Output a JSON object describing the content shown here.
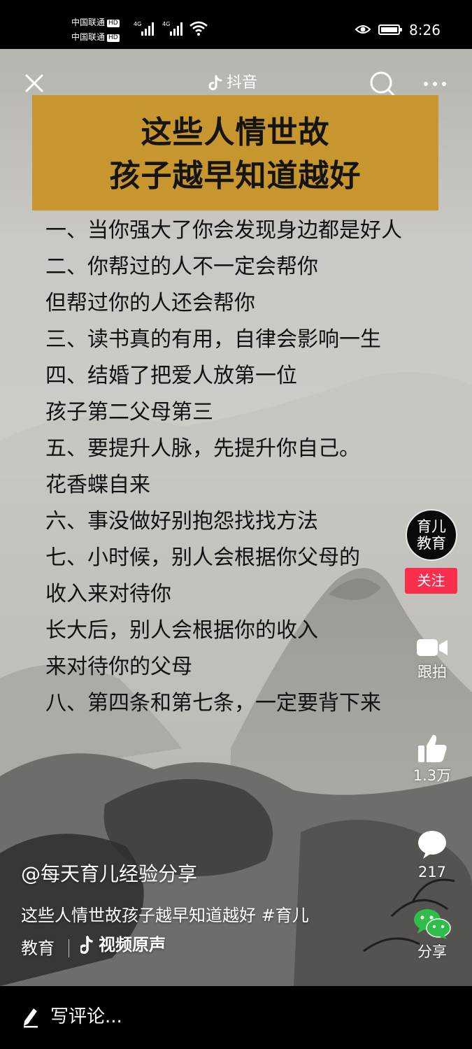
{
  "status_bar": {
    "carrier1": "中国联通",
    "carrier2": "中国联通",
    "hd_badge": "HD",
    "network1": "4G",
    "network2": "4G",
    "time": "8:26"
  },
  "top_bar": {
    "app_title": "抖音"
  },
  "video": {
    "title_lines": [
      "这些人情世故",
      "孩子越早知道越好"
    ],
    "content_lines": [
      "一、当你强大了你会发现身边都是好人",
      "二、你帮过的人不一定会帮你",
      "但帮过你的人还会帮你",
      "三、读书真的有用，自律会影响一生",
      "四、结婚了把爱人放第一位",
      "孩子第二父母第三",
      "五、要提升人脉，先提升你自己。",
      "花香蝶自来",
      "六、事没做好别抱怨找找方法",
      "七、小时候，别人会根据你父母的",
      "收入来对待你",
      "长大后，别人会根据你的收入",
      "来对待你的父母",
      "八、第四条和第七条，一定要背下来"
    ]
  },
  "right_rail": {
    "avatar_line1": "育儿",
    "avatar_line2": "教育",
    "follow_label": "关注",
    "duet_label": "跟拍",
    "like_count": "1.3万",
    "comment_count": "217",
    "share_label": "分享"
  },
  "caption": {
    "author": "@每天育儿经验分享",
    "line1_text": "这些人情世故孩子越早知道越好 ",
    "hashtag_part1": "#育儿",
    "hashtag_part2": "教育",
    "music_label": "视频原声"
  },
  "comment_bar": {
    "placeholder": "写评论..."
  },
  "colors": {
    "banner": "#c8962f",
    "follow_button": "#fa2f4e",
    "share_green": "#2fbe4a"
  }
}
